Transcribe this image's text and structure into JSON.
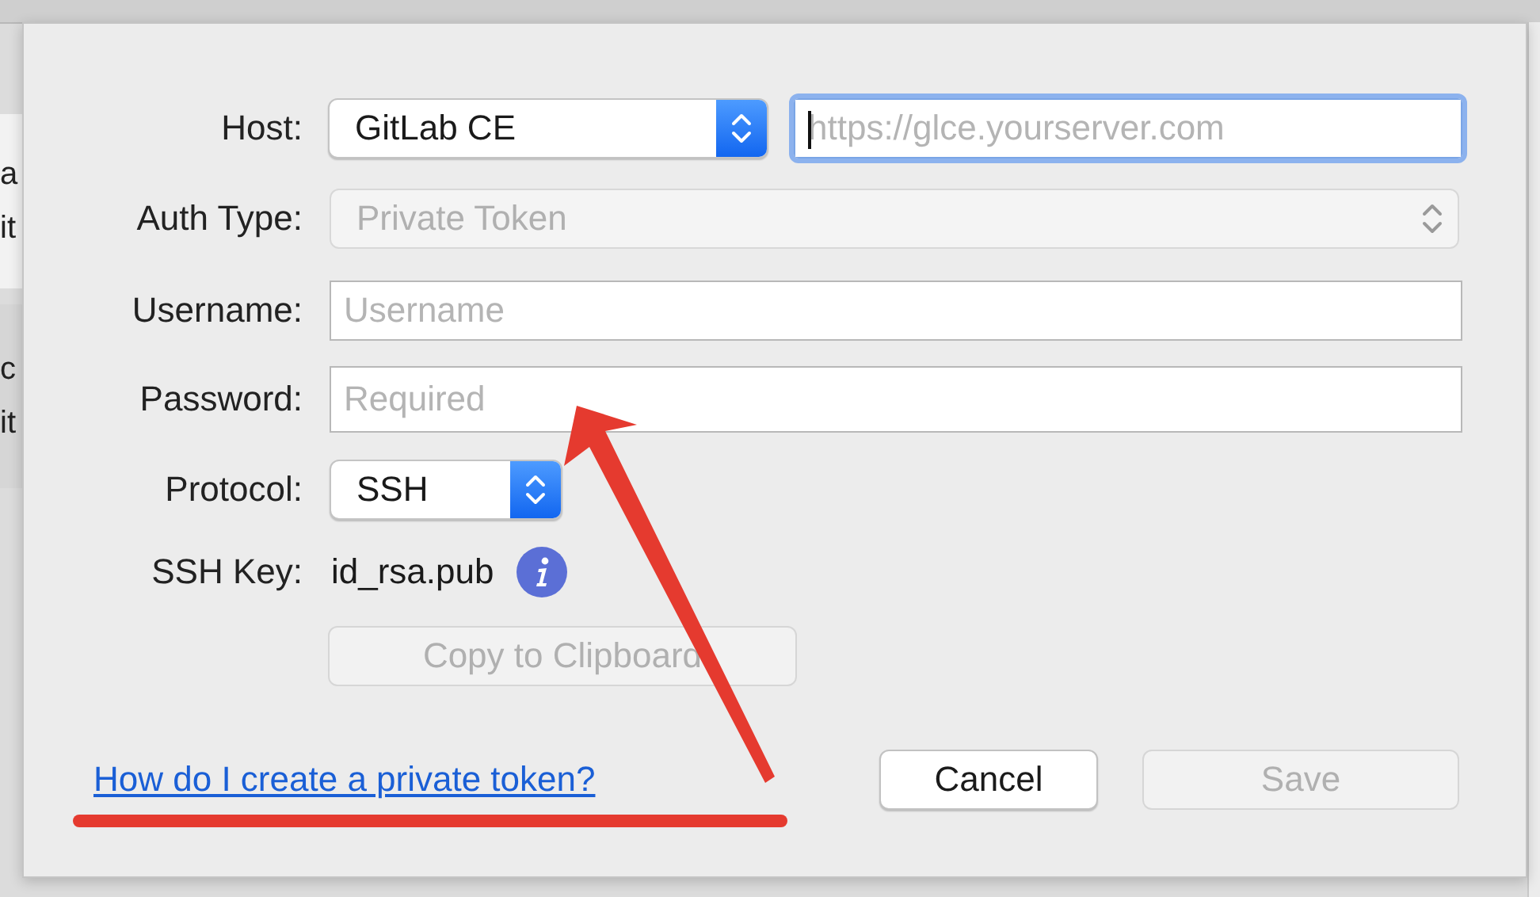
{
  "background_window": {
    "rows": [
      {
        "lines": [
          "a",
          "it"
        ],
        "selected": false
      },
      {
        "lines": [
          "c",
          "it"
        ],
        "selected": true
      }
    ]
  },
  "dialog": {
    "host": {
      "label": "Host:",
      "value": "GitLab CE",
      "url_placeholder": "https://glce.yourserver.com",
      "url_focused": true
    },
    "auth_type": {
      "label": "Auth Type:",
      "value": "Private Token",
      "disabled": true
    },
    "username": {
      "label": "Username:",
      "placeholder": "Username"
    },
    "password": {
      "label": "Password:",
      "placeholder": "Required"
    },
    "protocol": {
      "label": "Protocol:",
      "value": "SSH"
    },
    "ssh_key": {
      "label": "SSH Key:",
      "value": "id_rsa.pub"
    },
    "copy_button": {
      "label": "Copy to Clipboard",
      "disabled": true
    },
    "help_link": "How do I create a private token?",
    "buttons": [
      {
        "label": "Cancel",
        "disabled": false
      },
      {
        "label": "Save",
        "disabled": true
      }
    ]
  },
  "annotations": {
    "arrow": true,
    "underline": true
  }
}
